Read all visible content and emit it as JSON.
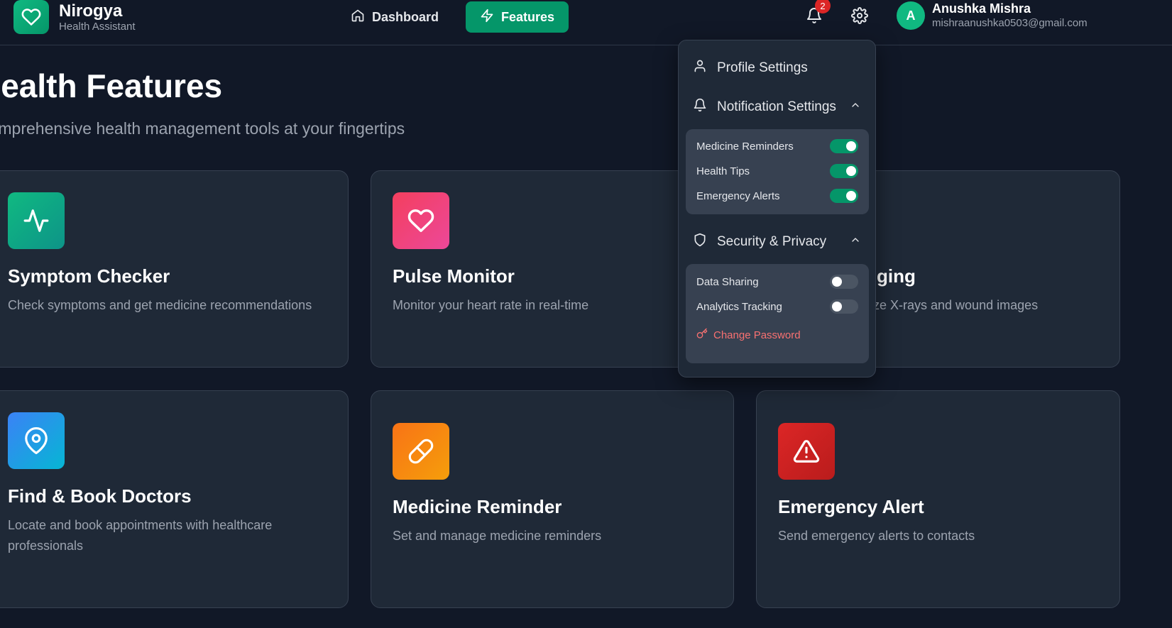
{
  "brand": {
    "name": "Nirogya",
    "subtitle": "Health Assistant"
  },
  "nav": {
    "dashboard_label": "Dashboard",
    "features_label": "Features"
  },
  "notifications": {
    "count": "2"
  },
  "user": {
    "initial": "A",
    "name": "Anushka Mishra",
    "email": "mishraanushka0503@gmail.com"
  },
  "page": {
    "title": "Health Features",
    "subtitle": "Comprehensive health management tools at your fingertips"
  },
  "cards": [
    {
      "title": "Symptom Checker",
      "description": "Check symptoms and get medicine recommendations",
      "icon": "activity-icon",
      "color": "#10b981"
    },
    {
      "title": "Pulse Monitor",
      "description": "Monitor your heart rate in real-time",
      "icon": "heart-icon",
      "color": "#ec4899"
    },
    {
      "title_visible": "ging",
      "description_visible": "ze X-rays and wound images"
    },
    {
      "title": "Find & Book Doctors",
      "description": "Locate and book appointments with healthcare professionals",
      "icon": "map-pin-icon",
      "color": "#0ea5e9"
    },
    {
      "title": "Medicine Reminder",
      "description": "Set and manage medicine reminders",
      "icon": "pill-icon",
      "color": "#f59e0b"
    },
    {
      "title": "Emergency Alert",
      "description": "Send emergency alerts to contacts",
      "icon": "alert-triangle-icon",
      "color": "#dc2626"
    }
  ],
  "settings_menu": {
    "profile_label": "Profile Settings",
    "notification_label": "Notification Settings",
    "notification_toggles": [
      {
        "label": "Medicine Reminders",
        "state": "on"
      },
      {
        "label": "Health Tips",
        "state": "on"
      },
      {
        "label": "Emergency Alerts",
        "state": "on"
      }
    ],
    "security_label": "Security & Privacy",
    "security_toggles": [
      {
        "label": "Data Sharing",
        "state": "off"
      },
      {
        "label": "Analytics Tracking",
        "state": "off"
      }
    ],
    "change_password_label": "Change Password"
  },
  "colors": {
    "accent": "#059669",
    "background": "#111827",
    "card": "#1f2937",
    "danger": "#f87171"
  }
}
